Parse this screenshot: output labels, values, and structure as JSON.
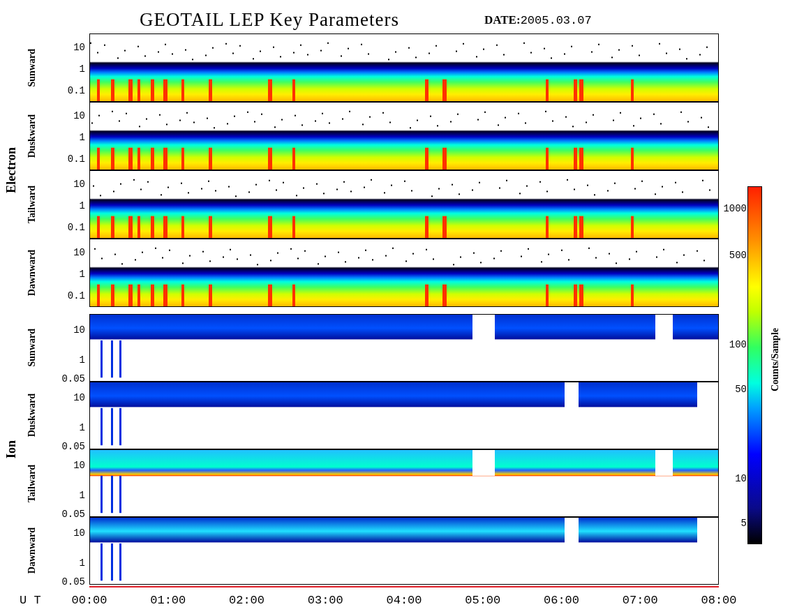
{
  "title": "GEOTAIL LEP Key Parameters",
  "date_label": "DATE:",
  "date": "2005.03.07",
  "groups": [
    {
      "label": "Electron",
      "kind": "electron",
      "panels": [
        {
          "label": "Sunward",
          "yticks": [
            "10",
            "1",
            "0.1"
          ]
        },
        {
          "label": "Duskward",
          "yticks": [
            "10",
            "1",
            "0.1"
          ]
        },
        {
          "label": "Tailward",
          "yticks": [
            "10",
            "1",
            "0.1"
          ]
        },
        {
          "label": "Dawnward",
          "yticks": [
            "10",
            "1",
            "0.1"
          ]
        }
      ]
    },
    {
      "label": "Ion",
      "kind": "ion",
      "panels": [
        {
          "label": "Sunward",
          "yticks": [
            "10",
            "1",
            "0.05"
          ]
        },
        {
          "label": "Duskward",
          "yticks": [
            "10",
            "1",
            "0.05"
          ]
        },
        {
          "label": "Tailward",
          "yticks": [
            "10",
            "1",
            "0.05"
          ]
        },
        {
          "label": "Dawnward",
          "yticks": [
            "10",
            "1",
            "0.05"
          ]
        }
      ]
    }
  ],
  "x_axis": {
    "label": "U T",
    "ticks": [
      "00:00",
      "01:00",
      "02:00",
      "03:00",
      "04:00",
      "05:00",
      "06:00",
      "07:00",
      "08:00"
    ]
  },
  "colorbar": {
    "label": "Counts/Sample",
    "ticks": [
      "1000",
      "500",
      "100",
      "50",
      "10",
      "5"
    ]
  }
}
